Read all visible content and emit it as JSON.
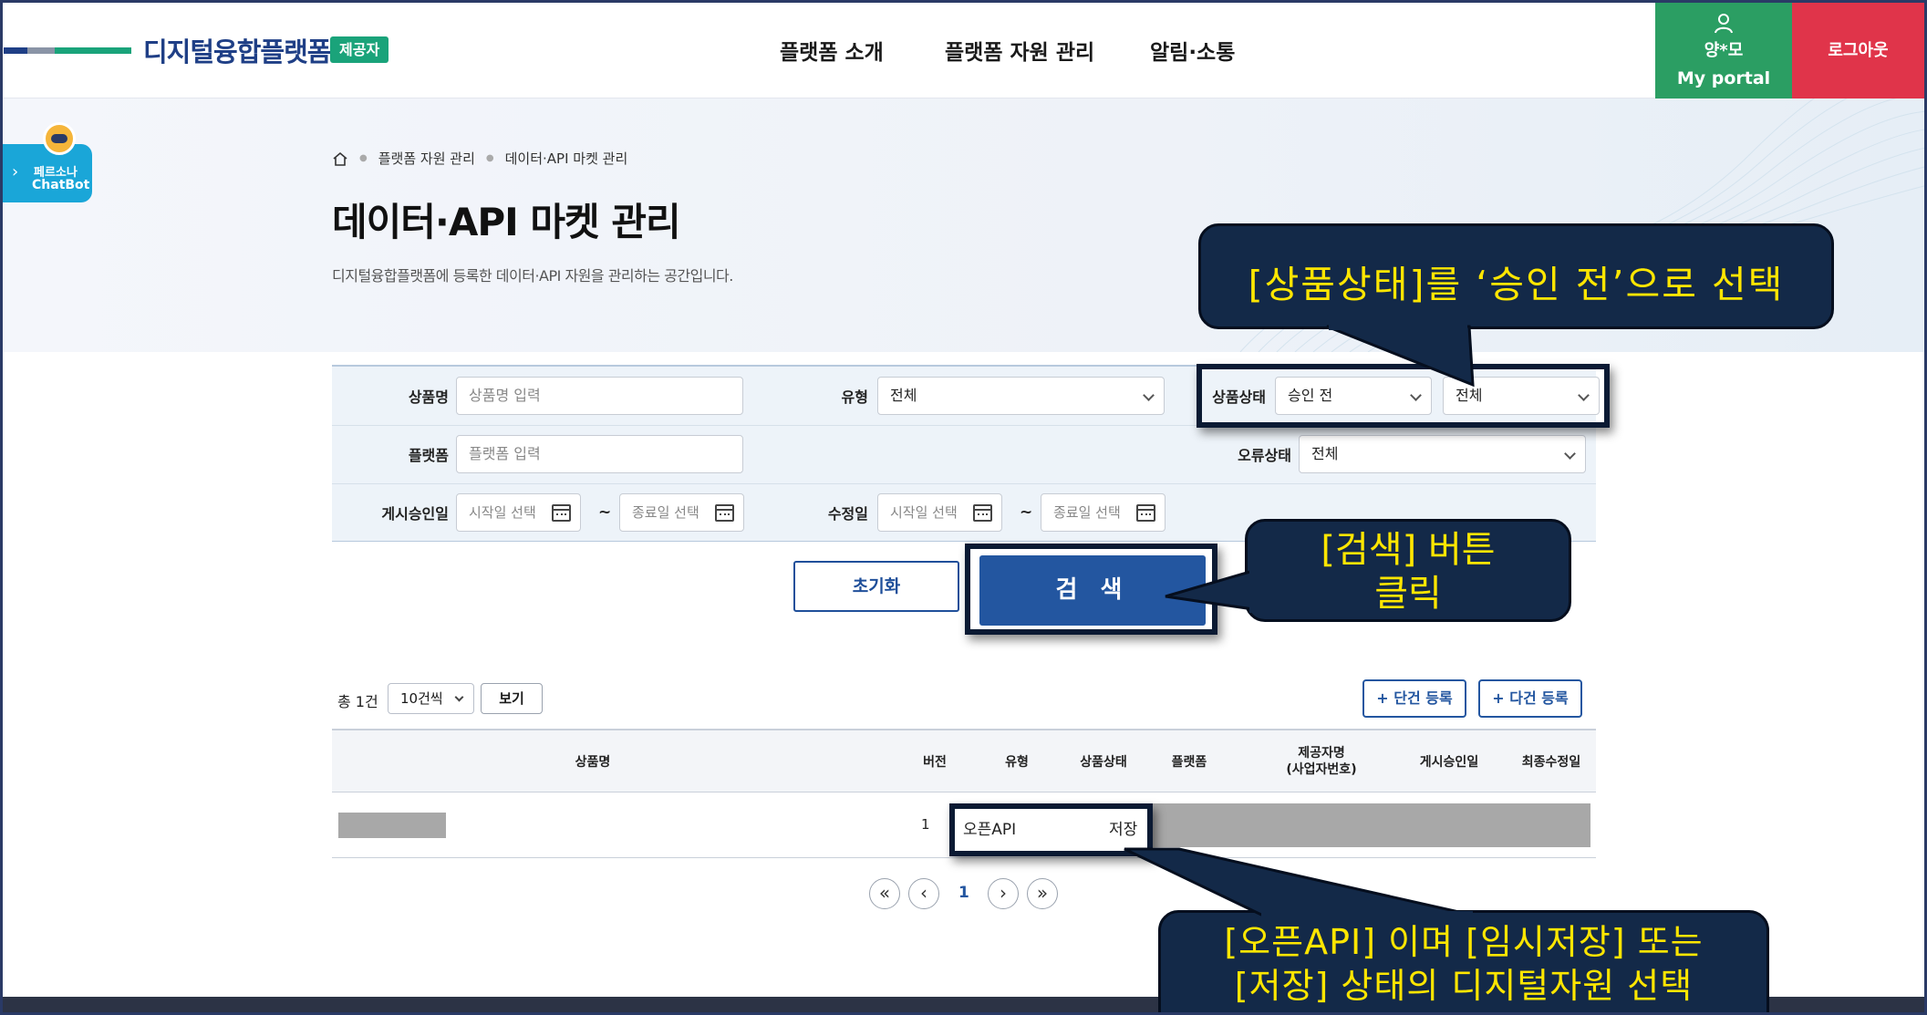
{
  "header": {
    "logo_text": "디지털융합플랫폼",
    "badge": "제공자",
    "nav": [
      "플랫폼 소개",
      "플랫폼 자원 관리",
      "알림·소통"
    ],
    "user_name": "양*모",
    "portal_label": "My portal",
    "logout_label": "로그아웃",
    "colors": {
      "portal": "#2b9e63",
      "logout": "#e0344a",
      "brand": "#1f3f86"
    }
  },
  "chatbot": {
    "line1": "페르소나",
    "line2": "ChatBot"
  },
  "breadcrumb": [
    "플랫폼 자원 관리",
    "데이터·API 마켓 관리"
  ],
  "page": {
    "title": "데이터·API 마켓 관리",
    "description": "디지털융합플랫폼에 등록한 데이터·API 자원을 관리하는 공간입니다."
  },
  "filters": {
    "product_name": {
      "label": "상품명",
      "placeholder": "상품명 입력"
    },
    "type": {
      "label": "유형",
      "value": "전체"
    },
    "status": {
      "label": "상품상태",
      "value1": "승인 전",
      "value2": "전체"
    },
    "platform": {
      "label": "플랫폼",
      "placeholder": "플랫폼 입력"
    },
    "error_status": {
      "label": "오류상태",
      "value": "전체"
    },
    "approval_date": {
      "label": "게시승인일",
      "start_placeholder": "시작일 선택",
      "end_placeholder": "종료일 선택"
    },
    "modified_date": {
      "label": "수정일",
      "start_placeholder": "시작일 선택",
      "end_placeholder": "종료일 선택"
    },
    "range_sep": "~"
  },
  "buttons": {
    "reset": "초기화",
    "search": "검 색"
  },
  "list": {
    "total": "총 1건",
    "page_size": "10건씩",
    "view": "보기",
    "add_single": "+ 단건 등록",
    "add_multi": "+ 다건 등록"
  },
  "table": {
    "headers": {
      "name": "상품명",
      "version": "버전",
      "type": "유형",
      "status": "상품상태",
      "platform": "플랫폼",
      "provider_1": "제공자명",
      "provider_2": "(사업자번호)",
      "approved": "게시승인일",
      "modified": "최종수정일"
    },
    "rows": [
      {
        "version": "1",
        "type": "오픈API",
        "status": "저장"
      }
    ]
  },
  "pagination": {
    "current": "1"
  },
  "annotations": {
    "status_note": "[상품상태]를 ‘승인 전’으로 선택",
    "search_note_1": "[검색] 버튼",
    "search_note_2": "클릭",
    "row_note_1": "[오픈API] 이며 [임시저장] 또는",
    "row_note_2": "[저장] 상태의 디지털자원 선택"
  }
}
